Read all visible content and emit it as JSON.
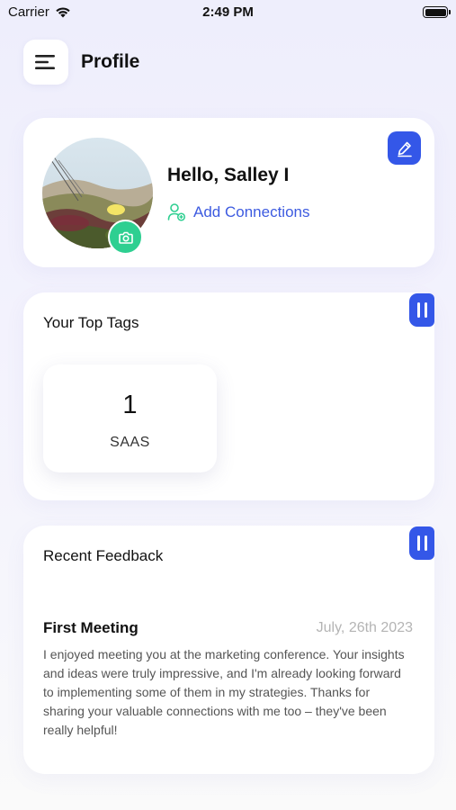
{
  "status_bar": {
    "carrier": "Carrier",
    "time": "2:49 PM"
  },
  "header": {
    "title": "Profile",
    "menu_icon": "hamburger-menu-icon"
  },
  "profile": {
    "greeting": "Hello, Salley I",
    "add_connections_label": "Add Connections",
    "camera_icon": "camera-icon",
    "edit_icon": "pencil-edit-icon",
    "avatar_accent": "#2ecf91"
  },
  "top_tags": {
    "title": "Your Top Tags",
    "tags": [
      {
        "count": "1",
        "name": "SAAS"
      }
    ]
  },
  "recent_feedback": {
    "title": "Recent Feedback",
    "items": [
      {
        "title": "First Meeting",
        "date": "July, 26th 2023",
        "body": "I enjoyed meeting you at the marketing conference. Your insights and ideas were truly impressive, and I'm already looking forward to implementing some of them in my strategies. Thanks for sharing your valuable connections with me too – they've been really helpful!"
      }
    ]
  },
  "colors": {
    "accent_blue": "#3457e8",
    "link_blue": "#3d5be0",
    "accent_green": "#2ecf91"
  }
}
